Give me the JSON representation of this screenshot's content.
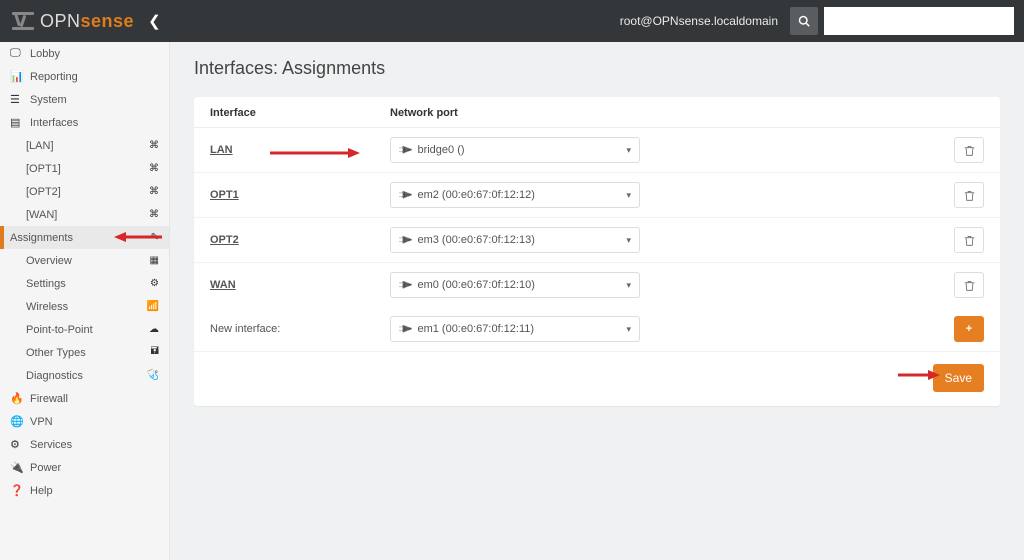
{
  "top": {
    "logo_opn": "OPN",
    "logo_sense": "sense",
    "user": "root@OPNsense.localdomain"
  },
  "menu": {
    "lobby": "Lobby",
    "reporting": "Reporting",
    "system": "System",
    "interfaces": "Interfaces",
    "lan": "[LAN]",
    "opt1": "[OPT1]",
    "opt2": "[OPT2]",
    "wan": "[WAN]",
    "assignments": "Assignments",
    "overview": "Overview",
    "settings": "Settings",
    "wireless": "Wireless",
    "ptp": "Point-to-Point",
    "other": "Other Types",
    "diag": "Diagnostics",
    "firewall": "Firewall",
    "vpn": "VPN",
    "services": "Services",
    "power": "Power",
    "help": "Help"
  },
  "page": {
    "title": "Interfaces: Assignments",
    "hdr_interface": "Interface",
    "hdr_port": "Network port",
    "new_interface": "New interface:",
    "save": "Save"
  },
  "rows": [
    {
      "label": "LAN",
      "port": "bridge0 ()"
    },
    {
      "label": "OPT1",
      "port": "em2 (00:e0:67:0f:12:12)"
    },
    {
      "label": "OPT2",
      "port": "em3 (00:e0:67:0f:12:13)"
    },
    {
      "label": "WAN",
      "port": "em0 (00:e0:67:0f:12:10)"
    }
  ],
  "new_port": "em1 (00:e0:67:0f:12:11)"
}
